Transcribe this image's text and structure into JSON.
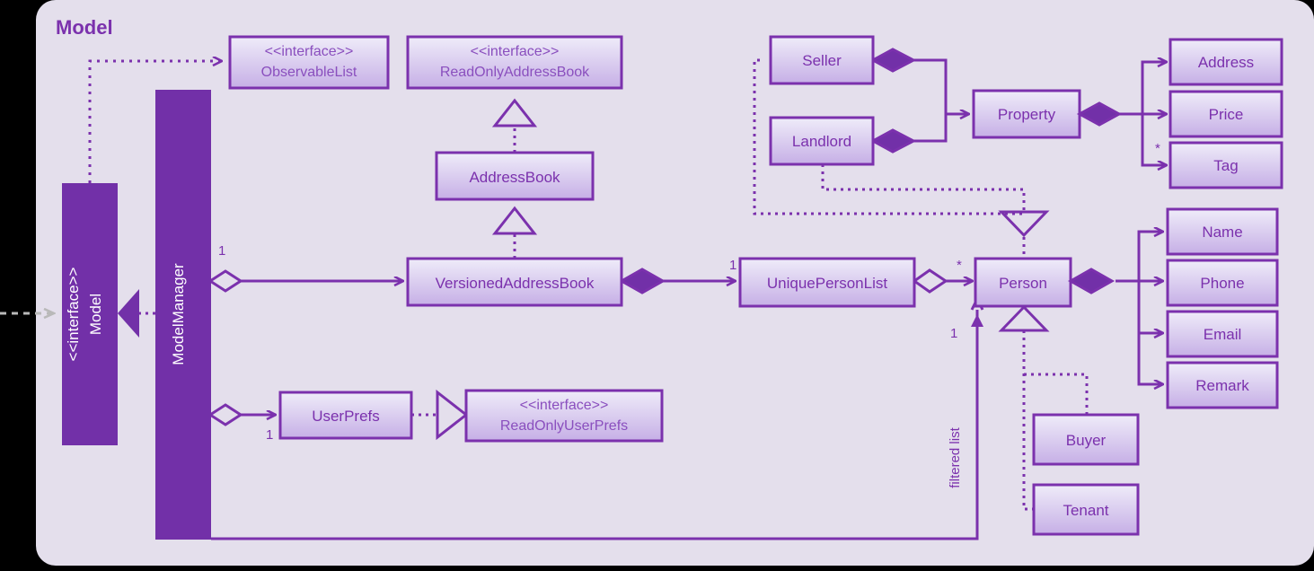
{
  "diagram": {
    "title": "Model",
    "type": "uml-class-diagram",
    "colors": {
      "panel_bg": "#e4dfec",
      "outer_bg": "#000000",
      "stroke": "#7b31ad",
      "box_fill_top": "#ece8f7",
      "box_fill_bottom": "#c9b3e8",
      "solid_fill": "#7230a8",
      "white_text": "#ffffff",
      "external_arrow": "#b9b9b9"
    }
  },
  "classes": {
    "observable_list": {
      "stereotype": "<<interface>>",
      "name": "ObservableList"
    },
    "read_only_address_book": {
      "stereotype": "<<interface>>",
      "name": "ReadOnlyAddressBook"
    },
    "address_book": {
      "name": "AddressBook"
    },
    "versioned_address_book": {
      "name": "VersionedAddressBook"
    },
    "model": {
      "stereotype": "<<interface>>",
      "name": "Model"
    },
    "model_manager": {
      "name": "ModelManager"
    },
    "user_prefs": {
      "name": "UserPrefs"
    },
    "read_only_user_prefs": {
      "stereotype": "<<interface>>",
      "name": "ReadOnlyUserPrefs"
    },
    "unique_person_list": {
      "name": "UniquePersonList"
    },
    "person": {
      "name": "Person"
    },
    "seller": {
      "name": "Seller"
    },
    "landlord": {
      "name": "Landlord"
    },
    "property": {
      "name": "Property"
    },
    "address": {
      "name": "Address"
    },
    "price": {
      "name": "Price"
    },
    "tag": {
      "name": "Tag"
    },
    "name_attr": {
      "name": "Name"
    },
    "phone": {
      "name": "Phone"
    },
    "email": {
      "name": "Email"
    },
    "remark": {
      "name": "Remark"
    },
    "buyer": {
      "name": "Buyer"
    },
    "tenant": {
      "name": "Tenant"
    }
  },
  "multiplicities": {
    "mm_to_vab": "1",
    "mm_to_userprefs": "1",
    "vab_to_upl": "1",
    "upl_to_person": "*",
    "person_to_tag": "*",
    "filtered_list_one": "1"
  },
  "labels": {
    "filtered_list": "filtered list"
  }
}
